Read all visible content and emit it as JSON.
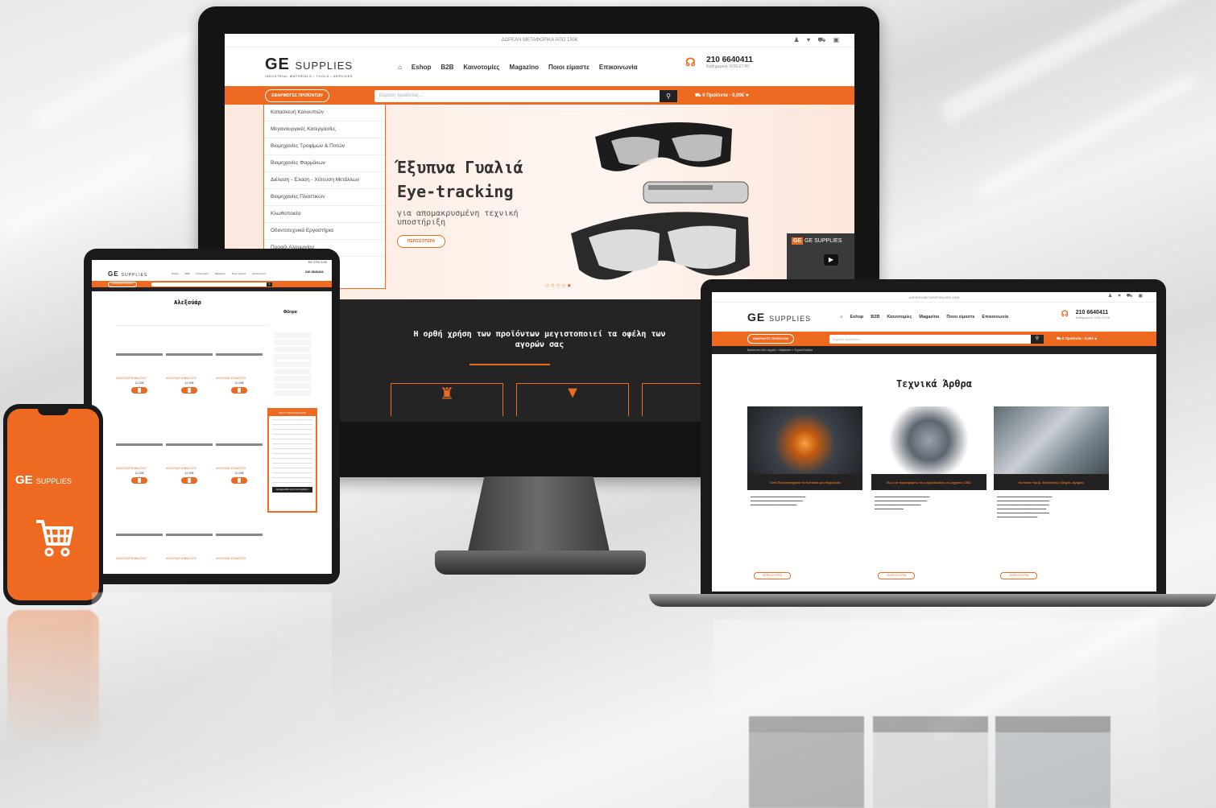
{
  "site": {
    "brand_main": "GE",
    "brand_sub": "SUPPLIES",
    "brand_tagline": "INDUSTRIAL MATERIALS • TOOLS • SERVICES",
    "top_strip": "ΔΩΡΕΑΝ ΜΕΤΑΦΟΡΙΚΑ ΑΠΟ 150€",
    "nav": [
      "Eshop",
      "B2B",
      "Καινοτομίες",
      "Magazino",
      "Ποιοι είμαστε",
      "Επικοινωνία"
    ],
    "phone": "210 6640411",
    "hours": "Καθημερινά: 9:00-17:00",
    "offers_button": "ΕΦΑΡΜΟΓΕΣ ΠΡΟΪΟΝΤΩΝ",
    "search_placeholder": "Εύρεση προϊόντος...",
    "cart": "0 Προϊόντα - 0,00€"
  },
  "monitor": {
    "menu": [
      "Κατασκευή Καλουπιών",
      "Μεγανουργικές Κατεργασίες",
      "Βιομηχανίες Τροφίμων & Ποτών",
      "Βιομηχανίες Φαρμάκων",
      "Διέλαση - Έλαση - Χύτευση Μετάλλων",
      "Βιομηχανίες Πλαστικών",
      "Κλωθοποιεία",
      "Οδοντοτεχνικά Εργαστήρια",
      "Προφίλ Αλουμινίου"
    ],
    "hero_title_1": "Έξυπνα Γυαλιά",
    "hero_title_2": "Eye-tracking",
    "hero_sub_1": "για απομακρυσμένη τεχνική",
    "hero_sub_2": "υποστήριξη",
    "hero_button": "ΠΕΡΙΣΣΟΤΕΡΑ",
    "video_label": "GE SUPPLIES",
    "dark_text_1": "Η ορθή χρήση των προϊόντων μεγιστοποιεί τα οφέλη των",
    "dark_text_2": "αγορών σας"
  },
  "tablet": {
    "status": "5G 37% 9:40",
    "page_title": "Αλεξούάρ",
    "filters_title": "Φίλτρα",
    "product_price": "12,00€",
    "panel_title": "ΝΕΟΙ ΤΥΠΟΙ ΚΟΙΛΑΡΟΝ",
    "panel_button": "Ενημερωθείτε για τα νέα προϊόντα"
  },
  "laptop": {
    "section_title": "Τεχνικά Άρθρα",
    "breadcrumb": "Βρίσκεστε εδώ: Αρχική > Magazino > Τεχνικά Άρθρα",
    "articles": [
      {
        "caption": "Γιατί Πλεονεκτήματα τα Κοπτικά μου Εργαλεία",
        "more": "ΠΕΡΙΣΣΟΤΕΡΑ"
      },
      {
        "caption": "Πώς να προσφέρετε τους εργαλειακές σε μηχανές CNC",
        "more": "ΠΕΡΙΣΣΟΤΕΡΑ"
      },
      {
        "caption": "Κοπτικά Υψηλ. Απόδοσης Οδηγός Αγοράς",
        "more": "ΠΕΡΙΣΣΟΤΕΡΑ"
      }
    ]
  },
  "colors": {
    "accent": "#ee6a21",
    "dark": "#242424"
  }
}
